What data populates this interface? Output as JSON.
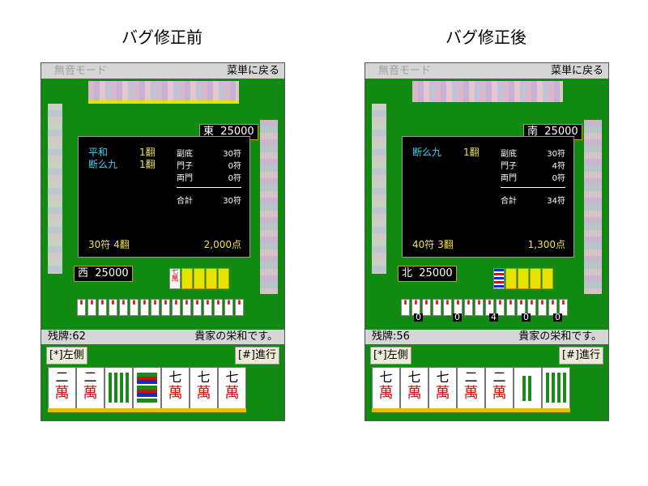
{
  "captions": {
    "before": "バグ修正前",
    "after": "バグ修正後"
  },
  "screens": [
    {
      "topbar": {
        "mute": "無音モード",
        "back": "菜単に戻る"
      },
      "east_tag": {
        "wind": "東",
        "score": "25000"
      },
      "west_tag": {
        "wind": "西",
        "score": "25000"
      },
      "dialog": {
        "yaku": [
          {
            "name": "平和",
            "han": "1翻"
          },
          {
            "name": "断么九",
            "han": "1翻"
          }
        ],
        "fu": [
          {
            "label": "副底",
            "value": "30符"
          },
          {
            "label": "門子",
            "value": "0符"
          },
          {
            "label": "両門",
            "value": "0符"
          }
        ],
        "total_label": "合計",
        "total_value": "30符",
        "summary": "30符 4翻",
        "points": "2,000点"
      },
      "status": {
        "left": "残牌:62",
        "right": "貴家の栄和です。"
      },
      "softkeys": {
        "left": "[*]左側",
        "right": "[#]進行"
      },
      "hand": [
        {
          "num": "二",
          "suit": "萬"
        },
        {
          "num": "二",
          "suit": "萬"
        },
        {
          "num": "",
          "suit": "bamboo"
        },
        {
          "num": "",
          "suit": "bamboo-mix"
        },
        {
          "num": "七",
          "suit": "萬"
        },
        {
          "num": "七",
          "suit": "萬"
        },
        {
          "num": "七",
          "suit": "萬"
        }
      ],
      "win_tile": {
        "num": "七",
        "suit": "萬"
      }
    },
    {
      "topbar": {
        "mute": "無音モード",
        "back": "菜単に戻る"
      },
      "east_tag": {
        "wind": "南",
        "score": "25000"
      },
      "west_tag": {
        "wind": "北",
        "score": "25000"
      },
      "dialog": {
        "yaku": [
          {
            "name": "断么九",
            "han": "1翻"
          }
        ],
        "fu": [
          {
            "label": "副底",
            "value": "30符"
          },
          {
            "label": "門子",
            "value": "4符"
          },
          {
            "label": "両門",
            "value": "0符"
          }
        ],
        "total_label": "合計",
        "total_value": "34符",
        "summary": "40符 3翻",
        "points": "1,300点"
      },
      "status": {
        "left": "残牌:56",
        "right": "貴家の栄和です。"
      },
      "softkeys": {
        "left": "[*]左側",
        "right": "[#]進行"
      },
      "hand": [
        {
          "num": "七",
          "suit": "萬"
        },
        {
          "num": "七",
          "suit": "萬"
        },
        {
          "num": "七",
          "suit": "萬"
        },
        {
          "num": "二",
          "suit": "萬"
        },
        {
          "num": "二",
          "suit": "萬"
        },
        {
          "num": "",
          "suit": "bamboo"
        },
        {
          "num": "",
          "suit": "bamboo"
        }
      ],
      "discard_counts": [
        "0",
        "0",
        "4",
        "0",
        "0"
      ]
    }
  ],
  "colors": {
    "table_green": "#118a11",
    "yaku_cyan": "#3fd0f0",
    "gold_text": "#f0e050",
    "tile_red": "#d01010",
    "tile_green": "#1a8a1a"
  }
}
